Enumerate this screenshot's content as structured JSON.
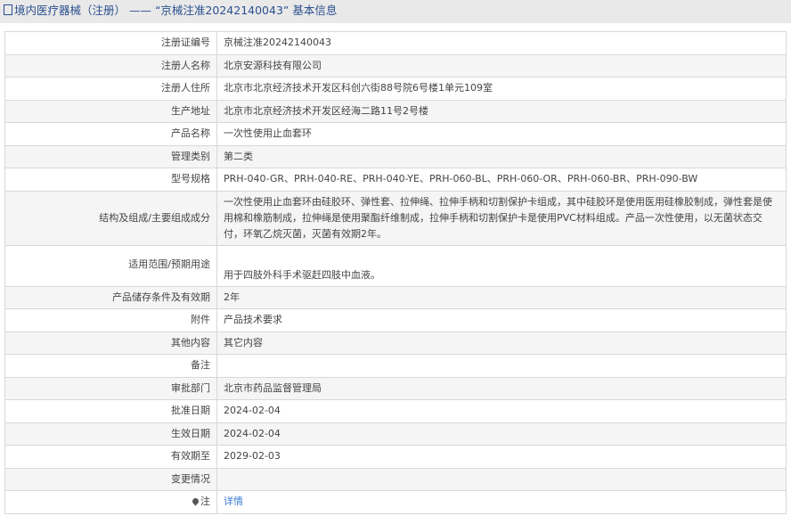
{
  "header": {
    "title": "境内医疗器械（注册） —— “京械注准20242140043” 基本信息"
  },
  "rows": [
    {
      "label": "注册证编号",
      "value": "京械注准20242140043"
    },
    {
      "label": "注册人名称",
      "value": "北京安源科技有限公司"
    },
    {
      "label": "注册人住所",
      "value": "北京市北京经济技术开发区科创六街88号院6号楼1单元109室"
    },
    {
      "label": "生产地址",
      "value": "北京市北京经济技术开发区经海二路11号2号楼"
    },
    {
      "label": "产品名称",
      "value": "一次性使用止血套环"
    },
    {
      "label": "管理类别",
      "value": "第二类"
    },
    {
      "label": "型号规格",
      "value": "PRH-040-GR、PRH-040-RE、PRH-040-YE、PRH-060-BL、PRH-060-OR、PRH-060-BR、PRH-090-BW"
    },
    {
      "label": "结构及组成/主要组成成分",
      "value": "一次性使用止血套环由硅胶环、弹性套、拉伸绳、拉伸手柄和切割保护卡组成，其中硅胶环是使用医用硅橡胶制成，弹性套是使用棉和橡筋制成，拉伸绳是使用聚酯纤维制成，拉伸手柄和切割保护卡是使用PVC材料组成。产品一次性使用，以无菌状态交付，环氧乙烷灭菌，灭菌有效期2年。"
    },
    {
      "label": "适用范围/预期用途",
      "value": "用于四肢外科手术驱赶四肢中血液。"
    },
    {
      "label": "产品储存条件及有效期",
      "value": "2年"
    },
    {
      "label": "附件",
      "value": "产品技术要求"
    },
    {
      "label": "其他内容",
      "value": "其它内容"
    },
    {
      "label": "备注",
      "value": ""
    },
    {
      "label": "审批部门",
      "value": "北京市药品监督管理局"
    },
    {
      "label": "批准日期",
      "value": "2024-02-04"
    },
    {
      "label": "生效日期",
      "value": "2024-02-04"
    },
    {
      "label": "有效期至",
      "value": "2029-02-03"
    },
    {
      "label": "变更情况",
      "value": ""
    }
  ],
  "note": {
    "label": "注",
    "link": "详情"
  }
}
